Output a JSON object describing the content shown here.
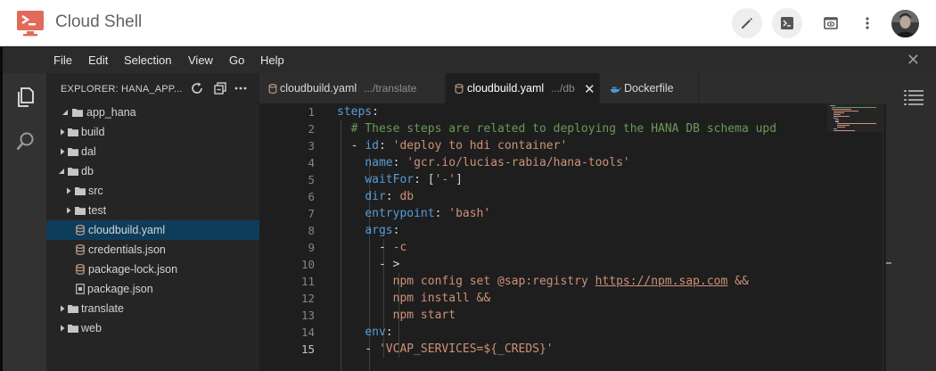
{
  "app": {
    "title": "Cloud Shell",
    "icons": [
      "cloud-shell-logo-icon",
      "edit-pencil-icon",
      "terminal-icon",
      "preview-icon",
      "more-vert-icon",
      "user-avatar"
    ]
  },
  "menubar": {
    "items": [
      "File",
      "Edit",
      "Selection",
      "View",
      "Go",
      "Help"
    ],
    "close_glyph": "✕"
  },
  "explorer": {
    "title": "EXPLORER: HANA_APP...",
    "tree": [
      {
        "label": "app_hana",
        "kind": "folder",
        "expanded": true,
        "depth": 0
      },
      {
        "label": "build",
        "kind": "folder",
        "expanded": false,
        "depth": 1
      },
      {
        "label": "dal",
        "kind": "folder",
        "expanded": false,
        "depth": 1
      },
      {
        "label": "db",
        "kind": "folder",
        "expanded": true,
        "depth": 1
      },
      {
        "label": "src",
        "kind": "folder",
        "expanded": false,
        "depth": 2
      },
      {
        "label": "test",
        "kind": "folder",
        "expanded": false,
        "depth": 2
      },
      {
        "label": "cloudbuild.yaml",
        "kind": "db-file",
        "depth": 2,
        "selected": true
      },
      {
        "label": "credentials.json",
        "kind": "db-file",
        "depth": 2
      },
      {
        "label": "package-lock.json",
        "kind": "db-file",
        "depth": 2
      },
      {
        "label": "package.json",
        "kind": "json-file",
        "depth": 2
      },
      {
        "label": "translate",
        "kind": "folder",
        "expanded": false,
        "depth": 1
      },
      {
        "label": "web",
        "kind": "folder",
        "expanded": false,
        "depth": 1
      }
    ]
  },
  "tabs": [
    {
      "name": "cloudbuild.yaml",
      "desc": ".../translate",
      "active": false
    },
    {
      "name": "cloudbuild.yaml",
      "desc": ".../db",
      "active": true,
      "close": "✕"
    },
    {
      "name": "Dockerfile",
      "desc": "",
      "active": false
    }
  ],
  "editor": {
    "current_line": 15,
    "lines": [
      {
        "n": "1",
        "tokens": [
          [
            "k",
            "steps"
          ],
          [
            "p",
            ":"
          ]
        ]
      },
      {
        "n": "2",
        "tokens": [
          [
            "p",
            "  "
          ],
          [
            "c",
            "# These steps are related to deploying the HANA DB schema upd"
          ]
        ]
      },
      {
        "n": "3",
        "tokens": [
          [
            "p",
            "  - "
          ],
          [
            "k",
            "id"
          ],
          [
            "p",
            ": "
          ],
          [
            "s",
            "'deploy to hdi container'"
          ]
        ]
      },
      {
        "n": "4",
        "tokens": [
          [
            "p",
            "    "
          ],
          [
            "k",
            "name"
          ],
          [
            "p",
            ": "
          ],
          [
            "s",
            "'gcr.io/lucias-rabia/hana-tools'"
          ]
        ]
      },
      {
        "n": "5",
        "tokens": [
          [
            "p",
            "    "
          ],
          [
            "k",
            "waitFor"
          ],
          [
            "p",
            ": ["
          ],
          [
            "s",
            "'-'"
          ],
          [
            "p",
            "]"
          ]
        ]
      },
      {
        "n": "6",
        "tokens": [
          [
            "p",
            "    "
          ],
          [
            "k",
            "dir"
          ],
          [
            "p",
            ": "
          ],
          [
            "s",
            "db"
          ]
        ]
      },
      {
        "n": "7",
        "tokens": [
          [
            "p",
            "    "
          ],
          [
            "k",
            "entrypoint"
          ],
          [
            "p",
            ": "
          ],
          [
            "s",
            "'bash'"
          ]
        ]
      },
      {
        "n": "8",
        "tokens": [
          [
            "p",
            "    "
          ],
          [
            "k",
            "args"
          ],
          [
            "p",
            ":"
          ]
        ]
      },
      {
        "n": "9",
        "tokens": [
          [
            "p",
            "      - "
          ],
          [
            "s",
            "-c"
          ]
        ]
      },
      {
        "n": "10",
        "tokens": [
          [
            "p",
            "      - >"
          ]
        ]
      },
      {
        "n": "11",
        "tokens": [
          [
            "p",
            "        "
          ],
          [
            "s",
            "npm config set @sap:registry "
          ],
          [
            "su",
            "https://npm.sap.com"
          ],
          [
            "s",
            " &&"
          ]
        ]
      },
      {
        "n": "12",
        "tokens": [
          [
            "p",
            "        "
          ],
          [
            "s",
            "npm install &&"
          ]
        ]
      },
      {
        "n": "13",
        "tokens": [
          [
            "p",
            "        "
          ],
          [
            "s",
            "npm start"
          ]
        ]
      },
      {
        "n": "14",
        "tokens": [
          [
            "p",
            "    "
          ],
          [
            "k",
            "env"
          ],
          [
            "p",
            ":"
          ]
        ]
      },
      {
        "n": "15",
        "tokens": [
          [
            "p",
            "    - "
          ],
          [
            "s",
            "'VCAP_SERVICES=${_CREDS}'"
          ]
        ]
      }
    ]
  },
  "colors": {
    "keyword": "#569cd6",
    "string": "#ce9178",
    "comment": "#6a9955",
    "selection": "#0e3d5c"
  }
}
